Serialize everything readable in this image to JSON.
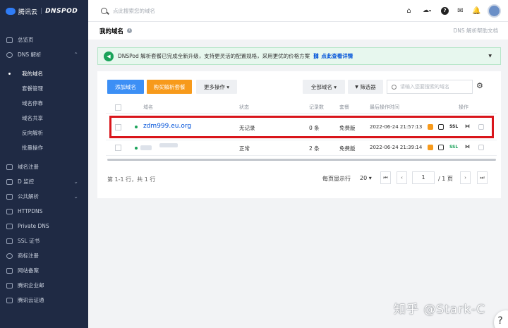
{
  "brand": {
    "name_cn": "腾讯云",
    "name_en": "DNSPOD"
  },
  "sidebar": {
    "items": [
      {
        "label": "总览页",
        "icon": "dashboard-icon"
      },
      {
        "label": "DNS 解析",
        "icon": "globe-icon",
        "expanded": true
      },
      {
        "label": "我的域名",
        "sub": true,
        "active": true
      },
      {
        "label": "套餐管理",
        "sub": true
      },
      {
        "label": "域名停靠",
        "sub": true
      },
      {
        "label": "域名共享",
        "sub": true
      },
      {
        "label": "反向解析",
        "sub": true
      },
      {
        "label": "批量操作",
        "sub": true
      },
      {
        "label": "域名注册",
        "icon": "card-icon"
      },
      {
        "label": "D 监控",
        "icon": "monitor-icon",
        "expandable": true
      },
      {
        "label": "公共解析",
        "icon": "network-icon",
        "expandable": true
      },
      {
        "label": "HTTPDNS",
        "icon": "nodes-icon"
      },
      {
        "label": "Private DNS",
        "icon": "lock-icon"
      },
      {
        "label": "SSL 证书",
        "icon": "certificate-icon"
      },
      {
        "label": "商标注册",
        "icon": "trademark-icon"
      },
      {
        "label": "网站备案",
        "icon": "record-icon"
      },
      {
        "label": "腾讯企业邮",
        "icon": "mail-icon"
      },
      {
        "label": "腾讯云证通",
        "icon": "id-icon"
      }
    ]
  },
  "topbar": {
    "search_placeholder": "点此搜索您的域名",
    "cloud_caret": "▾"
  },
  "page": {
    "title": "我的域名",
    "doc_link": "DNS 解析帮助文档"
  },
  "notice": {
    "message": "DNSPod 解析套餐已完成全新升级，支持更灵活的配置规格，采用更优的价格方案",
    "link": "点此查看详情"
  },
  "toolbar": {
    "add_domain": "添加域名",
    "buy_package": "购买解析套餐",
    "more_actions": "更多操作",
    "all_domains": "全部域名",
    "filter": "筛选器",
    "search_placeholder": "请输入您要搜索的域名"
  },
  "table": {
    "headers": {
      "domain": "域名",
      "status": "状态",
      "records": "记录数",
      "package": "套餐",
      "last_op": "最后操作时间",
      "ops": "操作"
    },
    "rows": [
      {
        "domain": "zdm999.eu.org",
        "status": "无记录",
        "records": "0 条",
        "package": "免费版",
        "last_op": "2022-06-24 21:57:13",
        "ssl": "SSL"
      },
      {
        "domain": "",
        "status": "正常",
        "records": "2 条",
        "package": "免费版",
        "last_op": "2022-06-24 21:39:14",
        "ssl": "SSL"
      }
    ]
  },
  "pagination": {
    "summary": "第 1-1 行，共 1 行",
    "per_page_label": "每页显示行",
    "per_page_value": "20 ▾",
    "current_page": "1",
    "total_pages": "/ 1 页"
  },
  "watermark": "知乎 @Stark-C",
  "colors": {
    "sidebar_bg": "#1f2a44",
    "primary": "#3c8ff5",
    "warning": "#f79a1b",
    "link": "#0052d9",
    "success": "#1aa35a",
    "highlight": "#d9151b"
  }
}
